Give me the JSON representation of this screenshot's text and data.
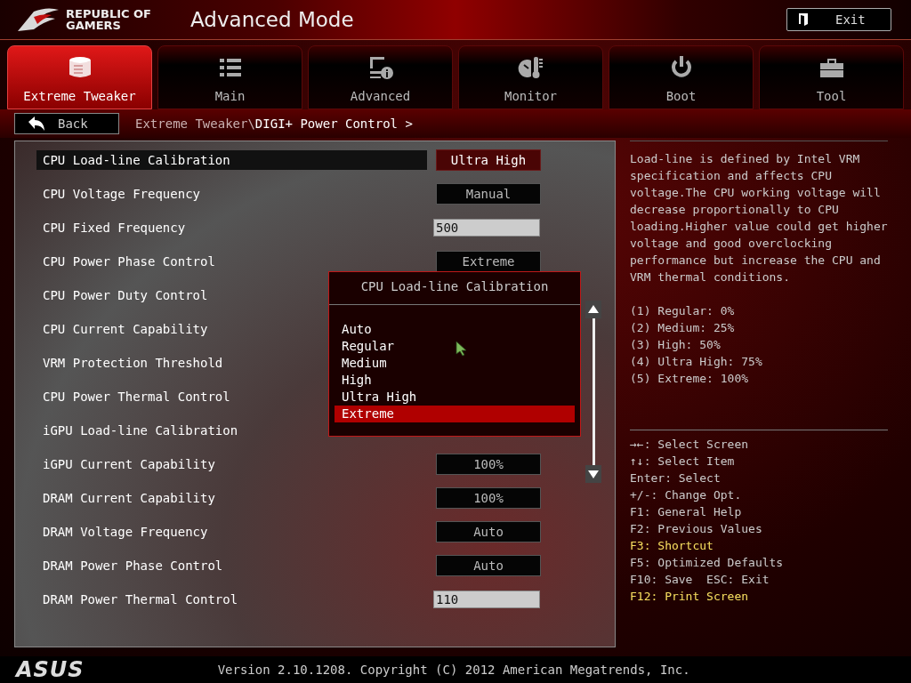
{
  "header": {
    "logo_line_1": "REPUBLIC OF",
    "logo_line_2": "GAMERS",
    "title": "Advanced Mode",
    "exit_label": "Exit"
  },
  "tabs": [
    {
      "label": "Extreme Tweaker",
      "kind": "tweaker",
      "selected": true
    },
    {
      "label": "Main",
      "kind": "list",
      "selected": false
    },
    {
      "label": "Advanced",
      "kind": "advanced",
      "selected": false
    },
    {
      "label": "Monitor",
      "kind": "monitor",
      "selected": false
    },
    {
      "label": "Boot",
      "kind": "power",
      "selected": false
    },
    {
      "label": "Tool",
      "kind": "tool",
      "selected": false
    }
  ],
  "back_label": "Back",
  "breadcrumb": {
    "parent": "Extreme Tweaker\\",
    "current": "DIGI+ Power Control >"
  },
  "settings": [
    {
      "label": "CPU Load-line Calibration",
      "kind": "select",
      "value": "Ultra High",
      "selected": true
    },
    {
      "label": "CPU Voltage Frequency",
      "kind": "select",
      "value": "Manual",
      "selected": false
    },
    {
      "label": "CPU Fixed Frequency",
      "kind": "input",
      "value": "500",
      "selected": false
    },
    {
      "label": "CPU Power Phase Control",
      "kind": "select",
      "value": "Extreme",
      "selected": false
    },
    {
      "label": "CPU Power Duty Control",
      "selected": false
    },
    {
      "label": "CPU Current Capability",
      "selected": false
    },
    {
      "label": "VRM Protection Threshold",
      "selected": false
    },
    {
      "label": "CPU Power Thermal Control",
      "selected": false
    },
    {
      "label": "iGPU Load-line Calibration",
      "selected": false
    },
    {
      "label": "iGPU Current Capability",
      "kind": "select",
      "value": "100%",
      "selected": false
    },
    {
      "label": "DRAM Current Capability",
      "kind": "select",
      "value": "100%",
      "selected": false
    },
    {
      "label": "DRAM Voltage Frequency",
      "kind": "select",
      "value": "Auto",
      "selected": false
    },
    {
      "label": "DRAM Power Phase Control",
      "kind": "select",
      "value": "Auto",
      "selected": false
    },
    {
      "label": "DRAM Power Thermal Control",
      "kind": "input",
      "value": "110",
      "selected": false
    }
  ],
  "popup": {
    "title": "CPU Load-line Calibration",
    "options": [
      {
        "label": "Auto",
        "selected": false
      },
      {
        "label": "Regular",
        "selected": false
      },
      {
        "label": "Medium",
        "selected": false
      },
      {
        "label": "High",
        "selected": false
      },
      {
        "label": "Ultra High",
        "selected": false
      },
      {
        "label": "Extreme",
        "selected": true
      }
    ]
  },
  "help": {
    "description": "Load-line is defined by Intel VRM specification and affects CPU voltage.The CPU working voltage will decrease proportionally to CPU loading.Higher value could get higher voltage and good overclocking performance but increase the CPU and VRM thermal conditions.",
    "levels": [
      "(1) Regular: 0%",
      "(2) Medium: 25%",
      "(3) High: 50%",
      "(4) Ultra High: 75%",
      "(5) Extreme: 100%"
    ]
  },
  "keys": [
    {
      "text": "→←: Select Screen",
      "highlight": false
    },
    {
      "text": "↑↓: Select Item",
      "highlight": false
    },
    {
      "text": "Enter: Select",
      "highlight": false
    },
    {
      "text": "+/-: Change Opt.",
      "highlight": false
    },
    {
      "text": "F1: General Help",
      "highlight": false
    },
    {
      "text": "F2: Previous Values",
      "highlight": false
    },
    {
      "text": "F3: Shortcut",
      "highlight": true
    },
    {
      "text": "F5: Optimized Defaults",
      "highlight": false
    },
    {
      "text": "F10: Save  ESC: Exit",
      "highlight": false
    },
    {
      "text": "F12: Print Screen",
      "highlight": true
    }
  ],
  "footer": {
    "brand": "ASUS",
    "version": "Version 2.10.1208. Copyright (C) 2012 American Megatrends, Inc."
  }
}
